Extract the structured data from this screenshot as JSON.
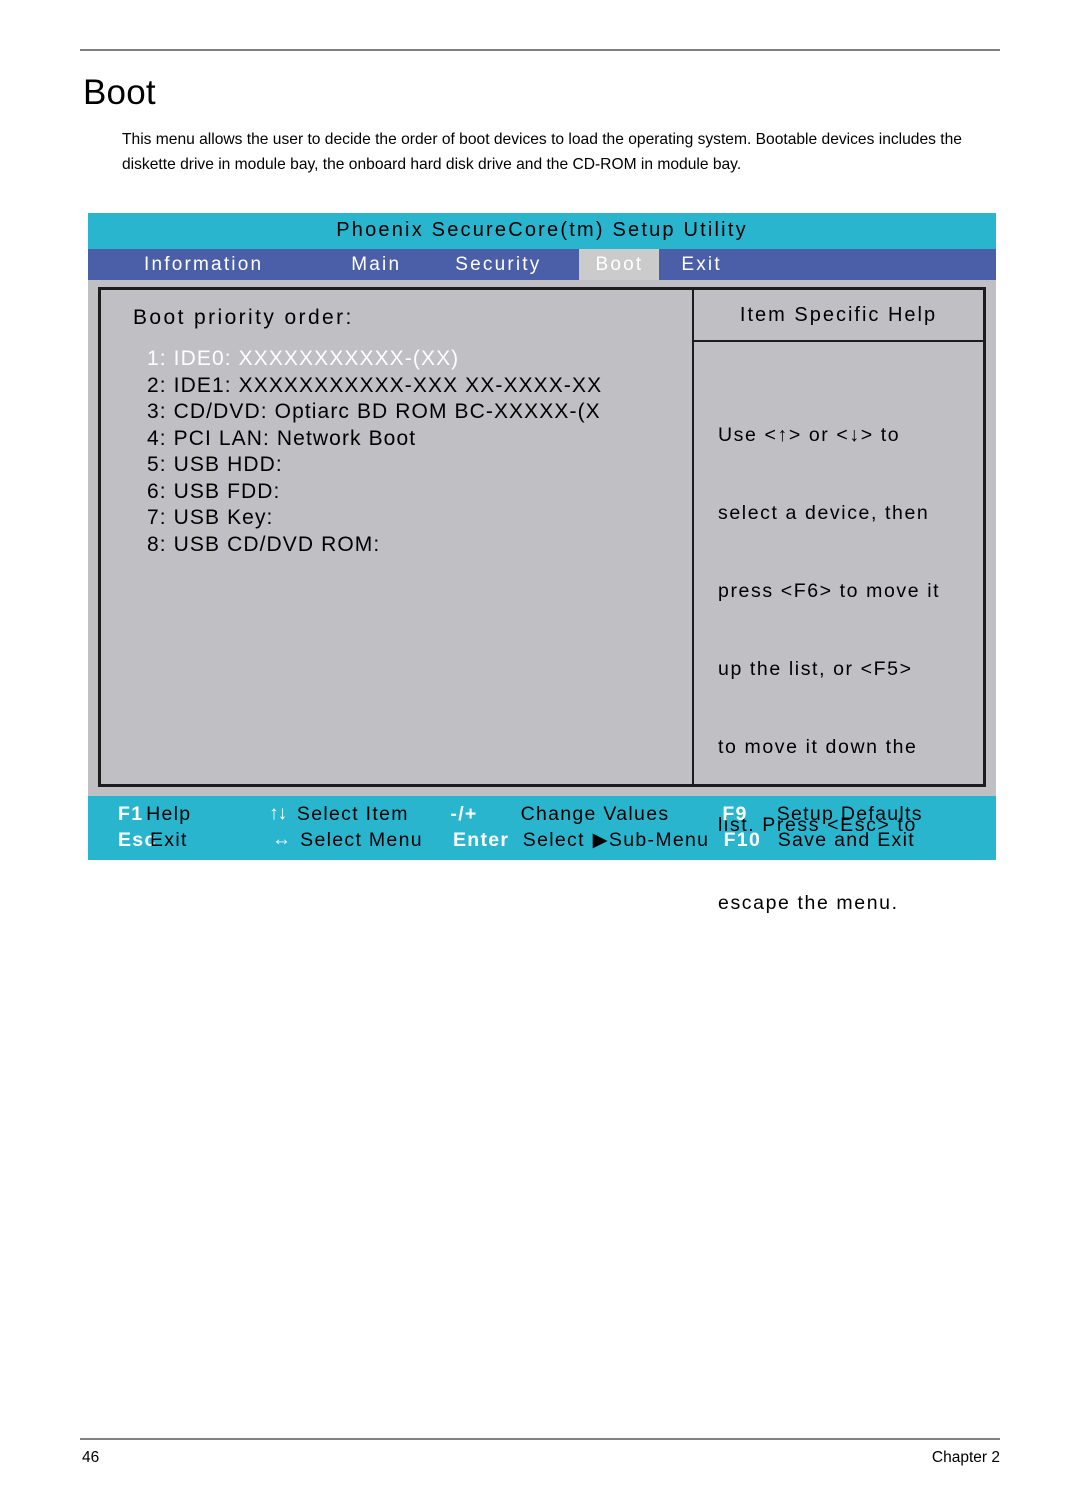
{
  "document": {
    "heading": "Boot",
    "intro": "This menu allows the user to decide the order of boot devices to load the operating system. Bootable devices includes the diskette drive in module bay, the onboard hard disk drive and the CD-ROM in module bay.",
    "footer_page_number": "46",
    "footer_chapter": "Chapter 2"
  },
  "bios": {
    "title": "Phoenix SecureCore(tm) Setup Utility",
    "menu_tabs": [
      {
        "label": "Information",
        "active": false
      },
      {
        "label": "Main",
        "active": false
      },
      {
        "label": "Security",
        "active": false
      },
      {
        "label": "Boot",
        "active": true
      },
      {
        "label": "Exit",
        "active": false
      }
    ],
    "colors": {
      "title_bar": "#2ab5cf",
      "menu_bar": "#4a5fa8",
      "active_tab": "#cbcbcb",
      "panel_bg": "#bfbfc4",
      "key_bar": "#2ab5cf",
      "selected_text": "#ffffff"
    },
    "left_panel": {
      "label": "Boot priority order:",
      "items": [
        {
          "index": "1:",
          "text": "IDE0: XXXXXXXXXXX-(XX)",
          "selected": true
        },
        {
          "index": "2:",
          "text": "IDE1: XXXXXXXXXXX-XXX XX-XXXX-XX",
          "selected": false
        },
        {
          "index": "3:",
          "text": "CD/DVD: Optiarc BD ROM BC-XXXXX-(X",
          "selected": false
        },
        {
          "index": "4:",
          "text": "PCI LAN: Network Boot",
          "selected": false
        },
        {
          "index": "5:",
          "text": "USB HDD:",
          "selected": false
        },
        {
          "index": "6:",
          "text": "USB FDD:",
          "selected": false
        },
        {
          "index": "7:",
          "text": "USB Key:",
          "selected": false
        },
        {
          "index": "8:",
          "text": "USB CD/DVD ROM:",
          "selected": false
        }
      ]
    },
    "help_panel": {
      "title": "Item Specific Help",
      "lines": [
        "Use <↑> or <↓> to",
        "select a device, then",
        "press <F6> to move it",
        "up the list, or <F5>",
        "to move it down the",
        "list. Press <Esc> to",
        "escape the menu."
      ]
    },
    "key_bar": {
      "row1": {
        "k1": "F1",
        "d1": "Help",
        "k2": "↑↓",
        "d2": "Select Item",
        "k3": "-/+",
        "d3": "Change Values",
        "k4": "F9",
        "d4": "Setup Defaults"
      },
      "row2": {
        "k1": "Esc",
        "d1": "Exit",
        "k2": "↔",
        "d2": "Select Menu",
        "k3": "Enter",
        "d3": "Select",
        "d3b": "▶Sub-Menu",
        "k4": "F10",
        "d4": "Save and Exit"
      }
    }
  }
}
